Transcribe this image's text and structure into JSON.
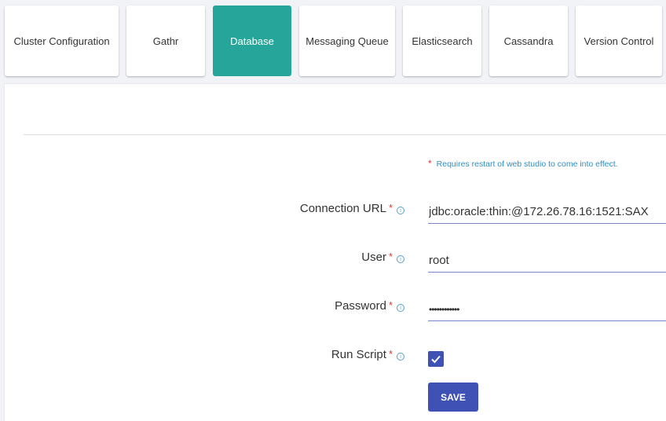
{
  "tabs": [
    {
      "label": "Cluster Configuration",
      "active": false
    },
    {
      "label": "Gathr",
      "active": false
    },
    {
      "label": "Database",
      "active": true
    },
    {
      "label": "Messaging Queue",
      "active": false
    },
    {
      "label": "Elasticsearch",
      "active": false
    },
    {
      "label": "Cassandra",
      "active": false
    },
    {
      "label": "Version Control",
      "active": false
    }
  ],
  "note": {
    "star": "*",
    "text": "Requires restart of web studio to come into effect."
  },
  "form": {
    "connection_url": {
      "label": "Connection URL",
      "required": "*",
      "value": "jdbc:oracle:thin:@172.26.78.16:1521:SAX"
    },
    "user": {
      "label": "User",
      "required": "*",
      "value": "root"
    },
    "password": {
      "label": "Password",
      "required": "*",
      "value": "••••••••••••"
    },
    "run_script": {
      "label": "Run Script",
      "required": "*",
      "checked": true
    },
    "info_glyph": "i"
  },
  "save_label": "SAVE",
  "colors": {
    "accent": "#26a69a",
    "primary": "#3f51b5",
    "required": "#e53935",
    "note": "#2f8fc4"
  }
}
